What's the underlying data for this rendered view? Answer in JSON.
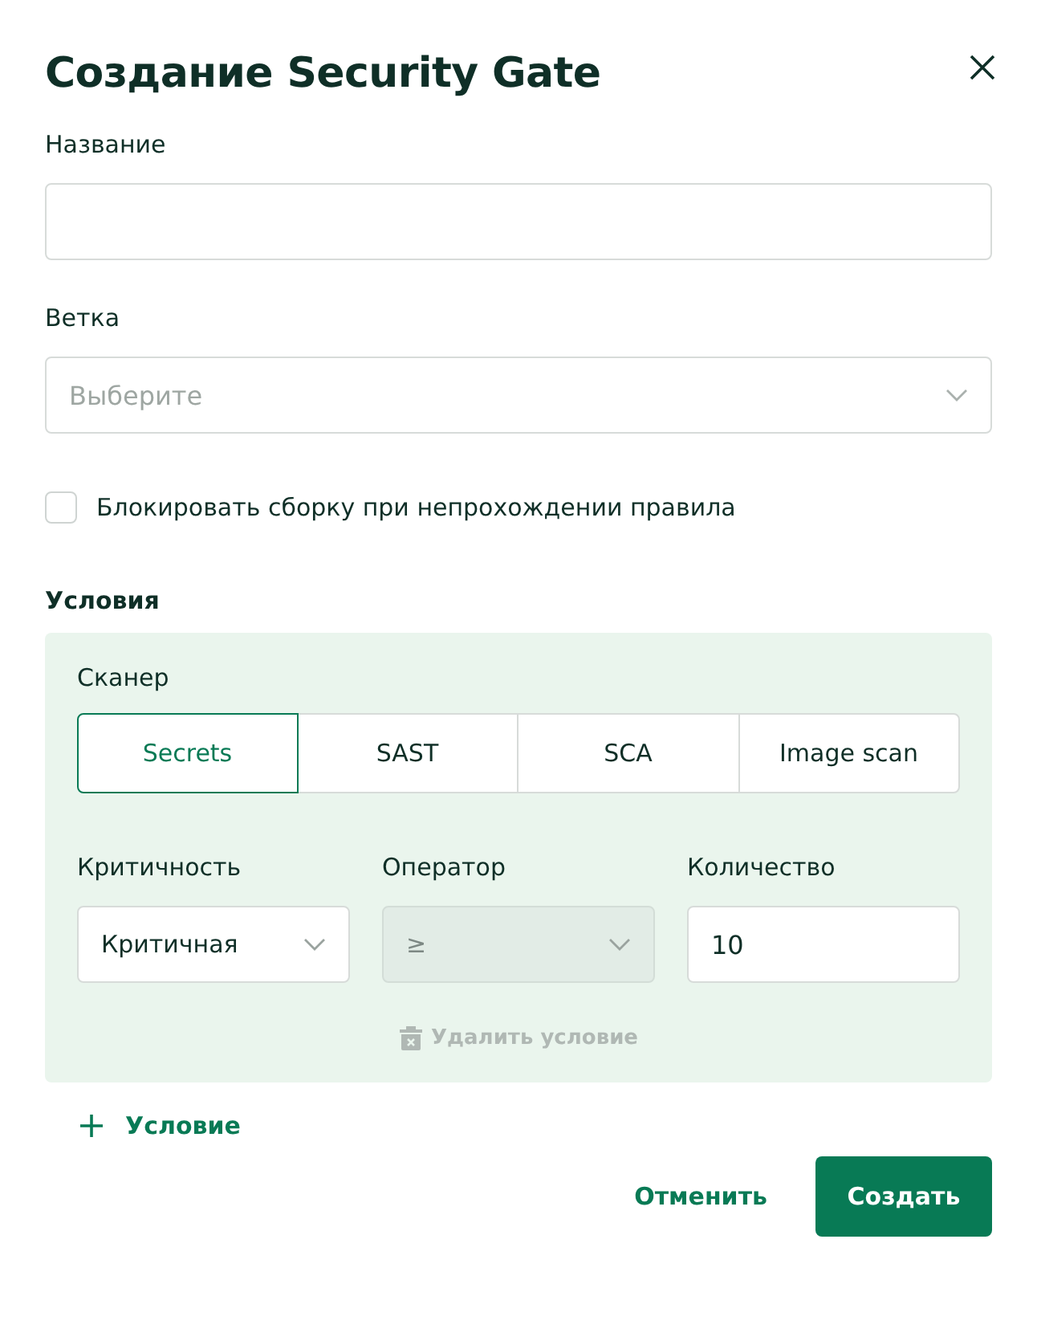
{
  "dialog": {
    "title": "Создание Security Gate"
  },
  "name_field": {
    "label": "Название"
  },
  "branch_field": {
    "label": "Ветка",
    "placeholder": "Выберите"
  },
  "block_checkbox": {
    "label": "Блокировать сборку при непрохождении правила",
    "checked": false
  },
  "conditions": {
    "heading": "Условия",
    "items": [
      {
        "scanner_label": "Сканер",
        "scanners": [
          {
            "label": "Secrets",
            "selected": true
          },
          {
            "label": "SAST",
            "selected": false
          },
          {
            "label": "SCA",
            "selected": false
          },
          {
            "label": "Image scan",
            "selected": false
          }
        ],
        "criticality": {
          "label": "Критичность",
          "value": "Критичная",
          "disabled": false
        },
        "operator": {
          "label": "Оператор",
          "value": "≥",
          "disabled": true
        },
        "count": {
          "label": "Количество",
          "value": "10"
        },
        "delete_button": {
          "label": "Удалить условие",
          "disabled": true
        }
      }
    ]
  },
  "add_condition": {
    "label": "Условие"
  },
  "buttons": {
    "cancel": "Отменить",
    "submit": "Создать"
  }
}
